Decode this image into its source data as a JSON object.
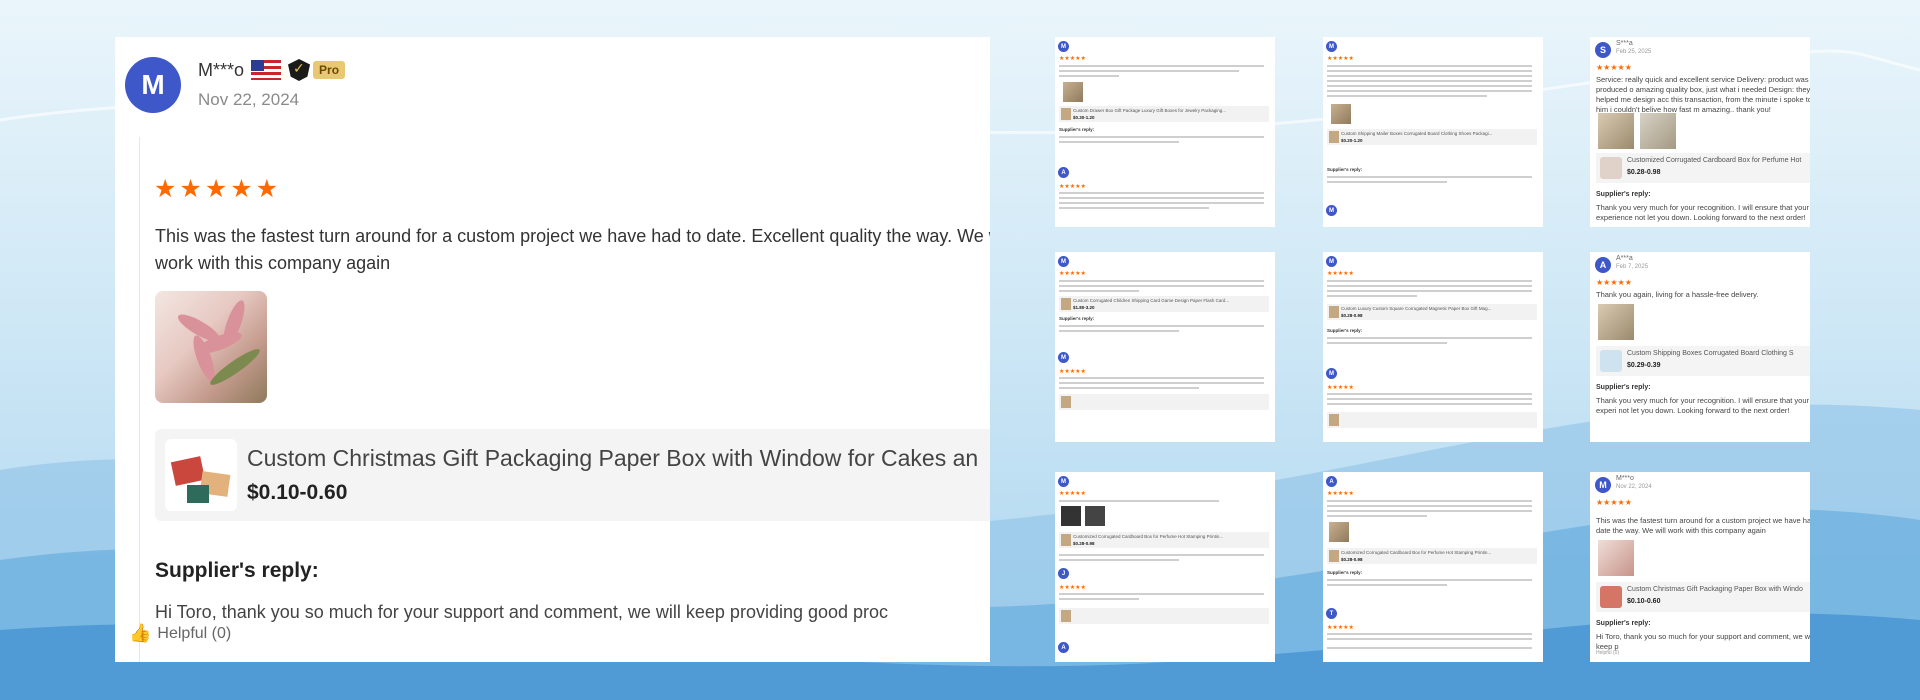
{
  "main_review": {
    "avatar_letter": "M",
    "name": "M***o",
    "badge": "Pro",
    "date": "Nov 22, 2024",
    "stars": "★★★★★",
    "text": "This was the fastest turn around for a custom project we have had to date. Excellent quality the way. We will work with this company again",
    "product": {
      "title": "Custom Christmas Gift Packaging Paper Box with Window for Cakes an",
      "price": "$0.10-0.60"
    },
    "reply_title": "Supplier's reply:",
    "reply_text": "Hi Toro, thank you so much for your support and comment, we will keep providing good proc",
    "helpful": "Helpful (0)"
  },
  "mini_reviews": [
    {
      "avatar": "M",
      "product_title": "Custom Drawer Box Gift Package Luxury Gift Boxes for Jewelry Packaging...",
      "product_price": "$0.30-1.20",
      "reply_label": "Supplier's reply:",
      "avatar2": "A"
    },
    {
      "avatar": "M",
      "product_title": "Custom Shipping Mailer Boxes Corrugated Board Clothing Shoes Packagi...",
      "product_price": "$0.20-1.20",
      "reply_label": "Supplier's reply:",
      "avatar2": "M"
    },
    {
      "avatar": "M",
      "product_title": "Custom Corrugated Children Shipping Card Game Design Paper Flash Card...",
      "product_price": "$1.80-3.20",
      "reply_label": "Supplier's reply:",
      "avatar2": "M"
    },
    {
      "avatar": "M",
      "product_title": "Custom Luxury Custom Square Corrugated Magnetic Paper Box Gift Mag...",
      "product_price": "$0.28-0.98",
      "reply_label": "Supplier's reply:",
      "avatar2": "M"
    },
    {
      "avatar": "M",
      "product_title": "Customized Corrugated Cardboard Box for Perfume Hot Stamping Printin...",
      "product_price": "$0.28-0.98",
      "reply_label": "Supplier's reply:",
      "avatar2": "J"
    },
    {
      "avatar": "A",
      "product_title": "Customized Corrugated Cardboard Box for Perfume Hot Stamping Printin...",
      "product_price": "$0.28-0.98",
      "reply_label": "Supplier's reply:",
      "avatar2": "T"
    }
  ],
  "right_reviews": [
    {
      "avatar": "S",
      "name": "S***a",
      "date": "Feb 25, 2025",
      "stars": "★★★★★",
      "text": "Service: really quick and excellent service Delivery: product was produced o amazing quality box, just what i needed Design: they helped me design acc this transaction, from the minute i spoke to him i couldn't belive how fast m amazing.. thank you!",
      "product_title": "Customized Corrugated Cardboard Box for Perfume Hot",
      "product_price": "$0.28-0.98",
      "reply_title": "Supplier's reply:",
      "reply_text": "Thank you very much for your recognition. I will ensure that your experience not let you down. Looking forward to the next order!"
    },
    {
      "avatar": "A",
      "name": "A***a",
      "date": "Feb 7, 2025",
      "stars": "★★★★★",
      "text": "Thank you again, living for a hassle-free delivery.",
      "product_title": "Custom Shipping Boxes Corrugated Board Clothing S",
      "product_price": "$0.29-0.39",
      "reply_title": "Supplier's reply:",
      "reply_text": "Thank you very much for your recognition. I will ensure that your experi not let you down. Looking forward to the next order!"
    },
    {
      "avatar": "M",
      "name": "M***o",
      "date": "Nov 22, 2024",
      "stars": "★★★★★",
      "text": "This was the fastest turn around for a custom project we have had to date the way. We will work with this company again",
      "product_title": "Custom Christmas Gift Packaging Paper Box with Windo",
      "product_price": "$0.10-0.60",
      "reply_title": "Supplier's reply:",
      "reply_text": "Hi Toro, thank you so much for your support and comment, we will keep p",
      "helpful": "Helpful (0)"
    }
  ]
}
